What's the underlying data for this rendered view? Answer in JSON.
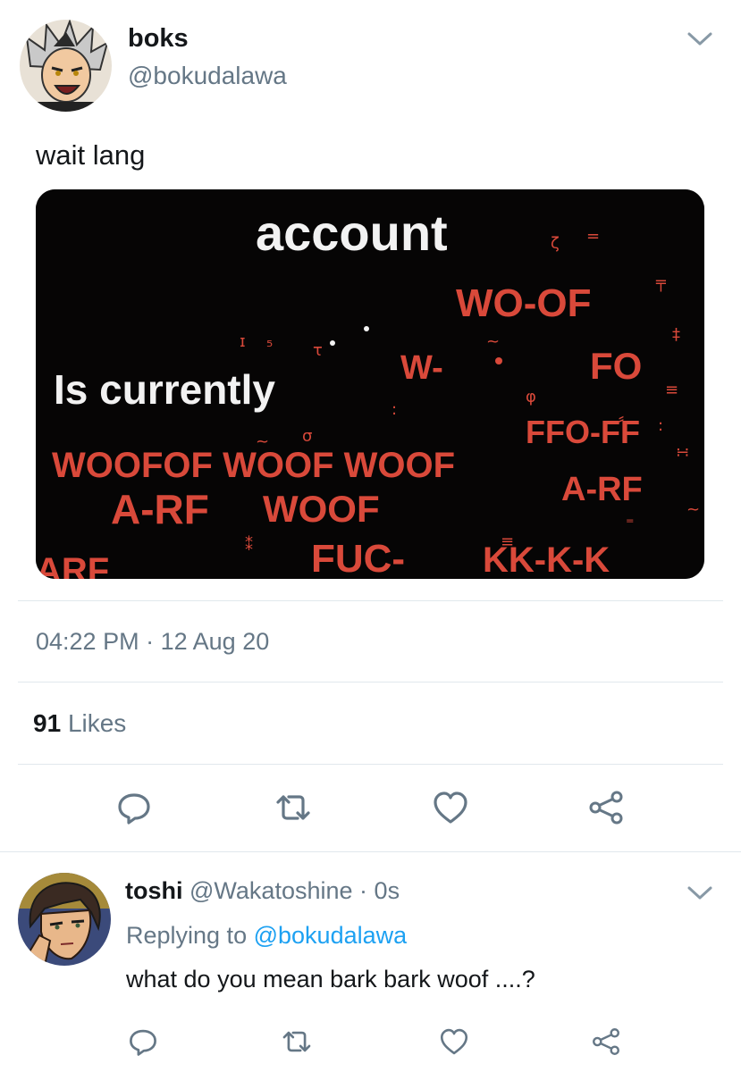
{
  "tweet": {
    "display_name": "boks",
    "handle": "@bokudalawa",
    "text": "wait lang",
    "avatar_icon": "anime-avatar-icon",
    "image": {
      "line1": "account",
      "line2": "Is currently",
      "woof_lines": [
        "WO-OF",
        "W-",
        "FO",
        "FFO-FF",
        "WOOFOF WOOF WOOF",
        "A-RF",
        "WOOF",
        "A-RF",
        "ARF",
        "FUC-",
        "KK-K-K"
      ]
    },
    "time": "04:22 PM",
    "separator": "·",
    "date": "12 Aug 20",
    "likes_count": "91",
    "likes_label": "Likes"
  },
  "actions": [
    "reply-icon",
    "retweet-icon",
    "like-icon",
    "share-icon"
  ],
  "reply": {
    "display_name": "toshi",
    "handle": "@Wakatoshine",
    "separator": "·",
    "time": "0s",
    "replying_prefix": "Replying to",
    "replying_handle": "@bokudalawa",
    "text": "what do you mean bark bark woof ....?"
  },
  "colors": {
    "text": "#14171a",
    "secondary": "#657786",
    "link": "#1da1f2",
    "divider": "#e1e8ed",
    "woof_red": "#d9493a"
  }
}
